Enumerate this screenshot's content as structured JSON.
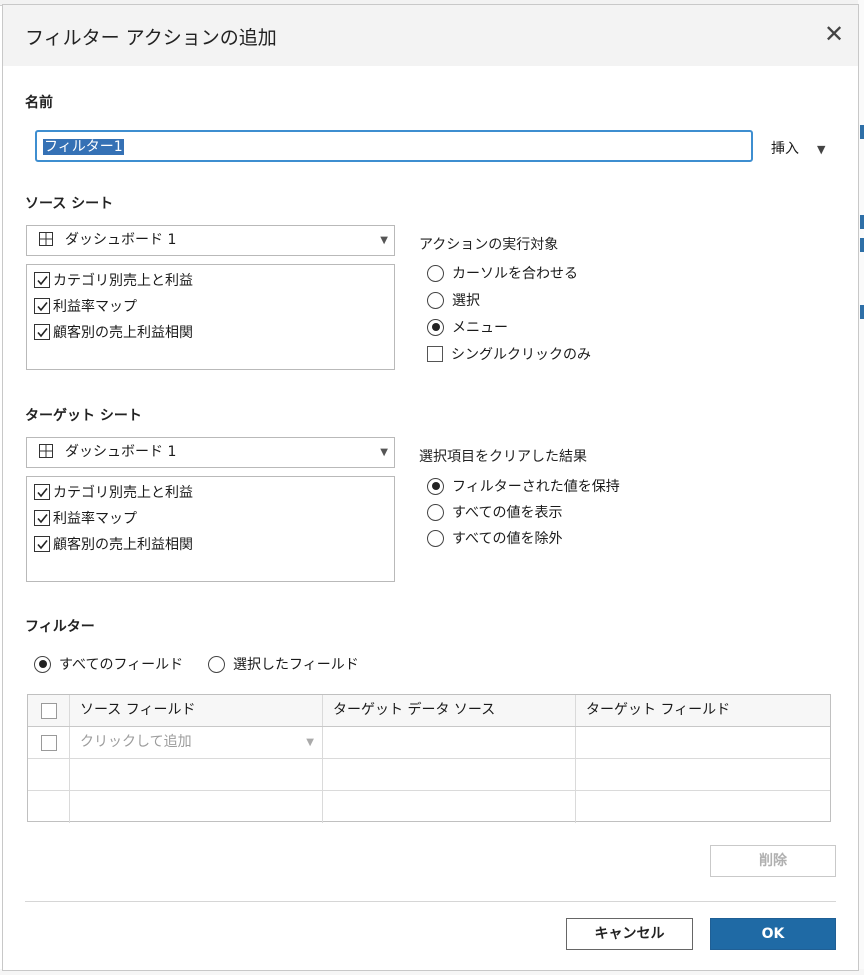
{
  "dialog": {
    "title": "フィルター アクションの追加"
  },
  "name": {
    "label": "名前",
    "value": "フィルター1",
    "insert_label": "挿入"
  },
  "source_sheet": {
    "label": "ソース シート",
    "dashboard": "ダッシュボード 1",
    "items": [
      {
        "label": "カテゴリ別売上と利益",
        "checked": true
      },
      {
        "label": "利益率マップ",
        "checked": true
      },
      {
        "label": "顧客別の売上利益相関",
        "checked": true
      }
    ]
  },
  "run_action_on": {
    "label": "アクションの実行対象",
    "options": [
      "カーソルを合わせる",
      "選択",
      "メニュー"
    ],
    "selected": "メニュー",
    "single_click_only": "シングルクリックのみ"
  },
  "target_sheet": {
    "label": "ターゲット シート",
    "dashboard": "ダッシュボード 1",
    "items": [
      {
        "label": "カテゴリ別売上と利益",
        "checked": true
      },
      {
        "label": "利益率マップ",
        "checked": true
      },
      {
        "label": "顧客別の売上利益相関",
        "checked": true
      }
    ]
  },
  "clearing_selection": {
    "label": "選択項目をクリアした結果",
    "options": [
      "フィルターされた値を保持",
      "すべての値を表示",
      "すべての値を除外"
    ],
    "selected": "フィルターされた値を保持"
  },
  "filters": {
    "label": "フィルター",
    "all_fields": "すべてのフィールド",
    "selected_fields": "選択したフィールド",
    "selected": "すべてのフィールド",
    "columns": [
      "ソース フィールド",
      "ターゲット データ ソース",
      "ターゲット フィールド"
    ],
    "add_placeholder": "クリックして追加"
  },
  "buttons": {
    "delete": "削除",
    "cancel": "キャンセル",
    "ok": "OK"
  },
  "colors": {
    "accent": "#1f6aa5",
    "focus_border": "#3e8ed0",
    "selection": "#3571b5"
  },
  "icons": {
    "close": "close-icon",
    "dropdown": "chevron-down-icon",
    "dashboard": "dashboard-grid-icon"
  }
}
